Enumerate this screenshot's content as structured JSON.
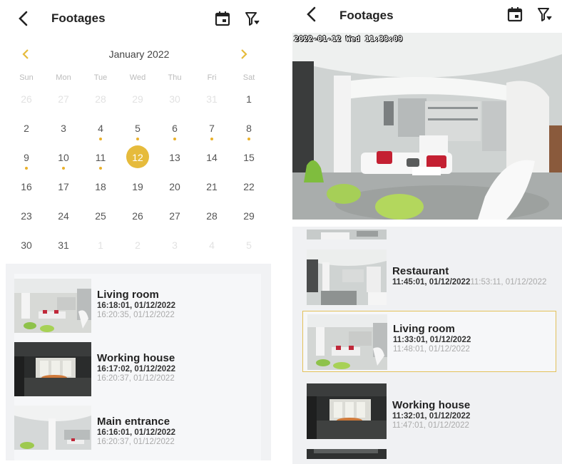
{
  "left": {
    "header": {
      "title": "Footages"
    },
    "icons": {
      "back": "back-arrow-icon",
      "calendar": "calendar-icon",
      "filter": "filter-icon"
    },
    "calendar": {
      "month_label": "January 2022",
      "weekdays": [
        "Sun",
        "Mon",
        "Tue",
        "Wed",
        "Thu",
        "Fri",
        "Sat"
      ],
      "weeks": [
        [
          {
            "d": "26",
            "m": true
          },
          {
            "d": "27",
            "m": true
          },
          {
            "d": "28",
            "m": true
          },
          {
            "d": "29",
            "m": true
          },
          {
            "d": "30",
            "m": true
          },
          {
            "d": "31",
            "m": true
          },
          {
            "d": "1"
          }
        ],
        [
          {
            "d": "2"
          },
          {
            "d": "3"
          },
          {
            "d": "4",
            "dot": true
          },
          {
            "d": "5",
            "dot": true
          },
          {
            "d": "6",
            "dot": true
          },
          {
            "d": "7",
            "dot": true
          },
          {
            "d": "8",
            "dot": true
          }
        ],
        [
          {
            "d": "9",
            "dot": true
          },
          {
            "d": "10",
            "dot": true
          },
          {
            "d": "11",
            "dot": true
          },
          {
            "d": "12",
            "sel": true
          },
          {
            "d": "13"
          },
          {
            "d": "14"
          },
          {
            "d": "15"
          }
        ],
        [
          {
            "d": "16"
          },
          {
            "d": "17"
          },
          {
            "d": "18"
          },
          {
            "d": "19"
          },
          {
            "d": "20"
          },
          {
            "d": "21"
          },
          {
            "d": "22"
          }
        ],
        [
          {
            "d": "23"
          },
          {
            "d": "24"
          },
          {
            "d": "25"
          },
          {
            "d": "26"
          },
          {
            "d": "27"
          },
          {
            "d": "28"
          },
          {
            "d": "29"
          }
        ],
        [
          {
            "d": "30"
          },
          {
            "d": "31"
          },
          {
            "d": "1",
            "m": true
          },
          {
            "d": "2",
            "m": true
          },
          {
            "d": "3",
            "m": true
          },
          {
            "d": "4",
            "m": true
          },
          {
            "d": "5",
            "m": true
          }
        ]
      ],
      "accent_color": "#e6bb3c"
    },
    "recordings": [
      {
        "name": "Living room",
        "start": "16:18:01, 01/12/2022",
        "end": "16:20:35, 01/12/2022"
      },
      {
        "name": "Working house",
        "start": "16:17:02, 01/12/2022",
        "end": "16:20:37, 01/12/2022"
      },
      {
        "name": "Main entrance",
        "start": "16:16:01, 01/12/2022",
        "end": "16:20:37, 01/12/2022"
      }
    ]
  },
  "right": {
    "header": {
      "title": "Footages"
    },
    "video": {
      "timestamp": "2022-01-12 Wed 11:33:09"
    },
    "recordings": [
      {
        "name": "Restaurant",
        "start": "11:45:01, 01/12/2022",
        "end": "11:53:11, 01/12/2022"
      },
      {
        "name": "Living room",
        "start": "11:33:01, 01/12/2022",
        "end": "11:48:01, 01/12/2022",
        "selected": true
      },
      {
        "name": "Working house",
        "start": "11:32:01, 01/12/2022",
        "end": "11:47:01, 01/12/2022"
      }
    ]
  }
}
